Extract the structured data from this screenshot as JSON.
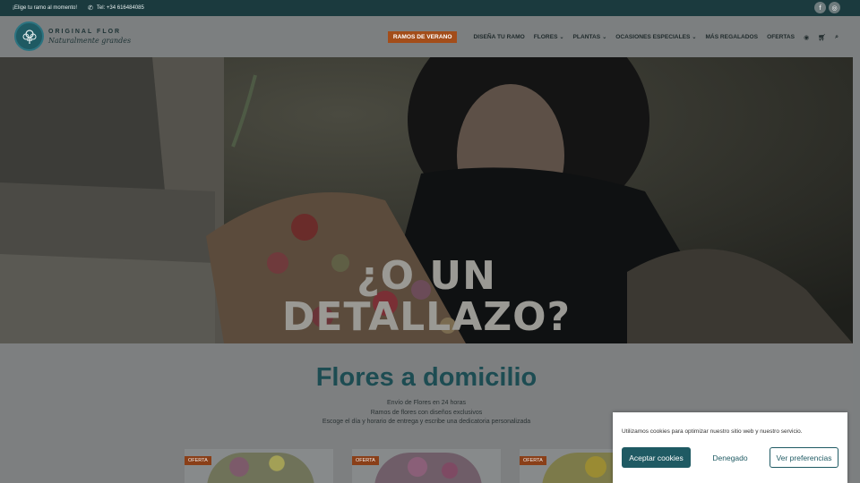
{
  "topbar": {
    "promo": "¡Elige tu ramo al momento!",
    "phone": "Tel: +34 616484085",
    "social": [
      "facebook-icon",
      "instagram-icon"
    ]
  },
  "logo": {
    "name": "ORIGINAL FLOR",
    "tagline": "Naturalmente grandes"
  },
  "nav": {
    "cta": "RAMOS DE VERANO",
    "items": [
      {
        "label": "DISEÑA TU RAMO"
      },
      {
        "label": "FLORES"
      },
      {
        "label": "PLANTAS"
      },
      {
        "label": "OCASIONES ESPECIALES"
      },
      {
        "label": "MÁS REGALADOS"
      },
      {
        "label": "OFERTAS"
      }
    ],
    "icons": [
      "user-icon",
      "cart-icon",
      "search-icon"
    ]
  },
  "hero": {
    "line1": "¿O UN",
    "line2": "DETALLAZO?"
  },
  "section": {
    "title": "Flores a domicilio",
    "lines": [
      "Envío de Flores en 24 horas",
      "Ramos de flores con diseños exclusivos",
      "Escoge el día y horario de entrega y escribe una dedicatoria personalizada"
    ]
  },
  "cards": [
    {
      "badge": "OFERTA"
    },
    {
      "badge": "OFERTA"
    },
    {
      "badge": "OFERTA"
    }
  ],
  "cookie": {
    "message": "Utilizamos cookies para optimizar nuestro sitio web y nuestro servicio.",
    "accept": "Aceptar cookies",
    "deny": "Denegado",
    "prefs": "Ver preferencias"
  },
  "colors": {
    "brand": "#1f5a63",
    "cta": "#a34d1a",
    "topbar": "#1b3a3e"
  }
}
